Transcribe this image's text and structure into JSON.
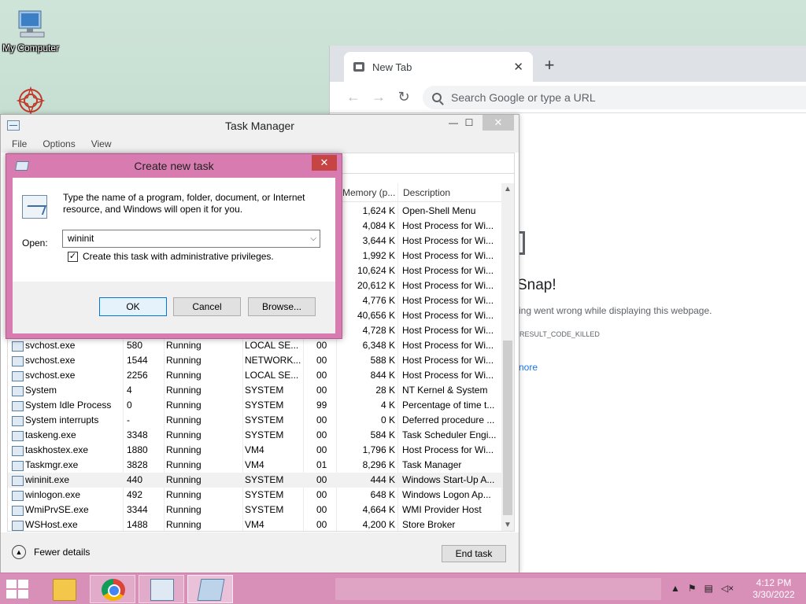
{
  "desktop": {
    "icons": [
      {
        "label": "My Computer"
      },
      {
        "label": ""
      }
    ]
  },
  "chrome": {
    "tab_title": "New Tab",
    "tab_close": "✕",
    "new_tab": "+",
    "omnibox_placeholder": "Search Google or type a URL",
    "crash_title": "Snap!",
    "crash_message": "ing went wrong while displaying this webpage.",
    "crash_code": ": RESULT_CODE_KILLED",
    "crash_link": "nore"
  },
  "task_manager": {
    "title": "Task Manager",
    "menu": [
      "File",
      "Options",
      "View"
    ],
    "window_buttons": {
      "minimize": "—",
      "maximize": "☐",
      "close": "✕"
    },
    "columns": {
      "memory": "Memory (p...",
      "description": "Description"
    },
    "rows": [
      {
        "name": "",
        "pid": "",
        "status": "",
        "user": "",
        "cpu": "",
        "mem": "1,624 K",
        "desc": "Open-Shell Menu"
      },
      {
        "name": "",
        "pid": "",
        "status": "",
        "user": "",
        "cpu": "",
        "mem": "4,084 K",
        "desc": "Host Process for Wi..."
      },
      {
        "name": "",
        "pid": "",
        "status": "",
        "user": "",
        "cpu": "",
        "mem": "3,644 K",
        "desc": "Host Process for Wi..."
      },
      {
        "name": "",
        "pid": "",
        "status": "",
        "user": "",
        "cpu": "",
        "mem": "1,992 K",
        "desc": "Host Process for Wi..."
      },
      {
        "name": "",
        "pid": "",
        "status": "",
        "user": "",
        "cpu": "",
        "mem": "10,624 K",
        "desc": "Host Process for Wi..."
      },
      {
        "name": "",
        "pid": "",
        "status": "",
        "user": "",
        "cpu": "",
        "mem": "20,612 K",
        "desc": "Host Process for Wi..."
      },
      {
        "name": "",
        "pid": "",
        "status": "",
        "user": "",
        "cpu": "",
        "mem": "4,776 K",
        "desc": "Host Process for Wi..."
      },
      {
        "name": "",
        "pid": "",
        "status": "",
        "user": "",
        "cpu": "",
        "mem": "40,656 K",
        "desc": "Host Process for Wi..."
      },
      {
        "name": "",
        "pid": "",
        "status": "",
        "user": "",
        "cpu": "",
        "mem": "4,728 K",
        "desc": "Host Process for Wi..."
      },
      {
        "name": "svchost.exe",
        "pid": "580",
        "status": "Running",
        "user": "LOCAL SE...",
        "cpu": "00",
        "mem": "6,348 K",
        "desc": "Host Process for Wi..."
      },
      {
        "name": "svchost.exe",
        "pid": "1544",
        "status": "Running",
        "user": "NETWORK...",
        "cpu": "00",
        "mem": "588 K",
        "desc": "Host Process for Wi..."
      },
      {
        "name": "svchost.exe",
        "pid": "2256",
        "status": "Running",
        "user": "LOCAL SE...",
        "cpu": "00",
        "mem": "844 K",
        "desc": "Host Process for Wi..."
      },
      {
        "name": "System",
        "pid": "4",
        "status": "Running",
        "user": "SYSTEM",
        "cpu": "00",
        "mem": "28 K",
        "desc": "NT Kernel & System"
      },
      {
        "name": "System Idle Process",
        "pid": "0",
        "status": "Running",
        "user": "SYSTEM",
        "cpu": "99",
        "mem": "4 K",
        "desc": "Percentage of time t..."
      },
      {
        "name": "System interrupts",
        "pid": "-",
        "status": "Running",
        "user": "SYSTEM",
        "cpu": "00",
        "mem": "0 K",
        "desc": "Deferred procedure ..."
      },
      {
        "name": "taskeng.exe",
        "pid": "3348",
        "status": "Running",
        "user": "SYSTEM",
        "cpu": "00",
        "mem": "584 K",
        "desc": "Task Scheduler Engi..."
      },
      {
        "name": "taskhostex.exe",
        "pid": "1880",
        "status": "Running",
        "user": "VM4",
        "cpu": "00",
        "mem": "1,796 K",
        "desc": "Host Process for Wi..."
      },
      {
        "name": "Taskmgr.exe",
        "pid": "3828",
        "status": "Running",
        "user": "VM4",
        "cpu": "01",
        "mem": "8,296 K",
        "desc": "Task Manager"
      },
      {
        "name": "wininit.exe",
        "pid": "440",
        "status": "Running",
        "user": "SYSTEM",
        "cpu": "00",
        "mem": "444 K",
        "desc": "Windows Start-Up A...",
        "selected": true
      },
      {
        "name": "winlogon.exe",
        "pid": "492",
        "status": "Running",
        "user": "SYSTEM",
        "cpu": "00",
        "mem": "648 K",
        "desc": "Windows Logon Ap..."
      },
      {
        "name": "WmiPrvSE.exe",
        "pid": "3344",
        "status": "Running",
        "user": "SYSTEM",
        "cpu": "00",
        "mem": "4,664 K",
        "desc": "WMI Provider Host"
      },
      {
        "name": "WSHost.exe",
        "pid": "1488",
        "status": "Running",
        "user": "VM4",
        "cpu": "00",
        "mem": "4,200 K",
        "desc": "Store Broker"
      }
    ],
    "fewer_details": "Fewer details",
    "end_task": "End task"
  },
  "dialog": {
    "title": "Create new task",
    "close": "✕",
    "message": "Type the name of a program, folder, document, or Internet resource, and Windows will open it for you.",
    "open_label": "Open:",
    "open_value": "wininit",
    "admin_checkbox_label": "Create this task with administrative privileges.",
    "admin_checked": true,
    "ok": "OK",
    "cancel": "Cancel",
    "browse": "Browse..."
  },
  "taskbar": {
    "clock_time": "4:12 PM",
    "clock_date": "3/30/2022"
  }
}
